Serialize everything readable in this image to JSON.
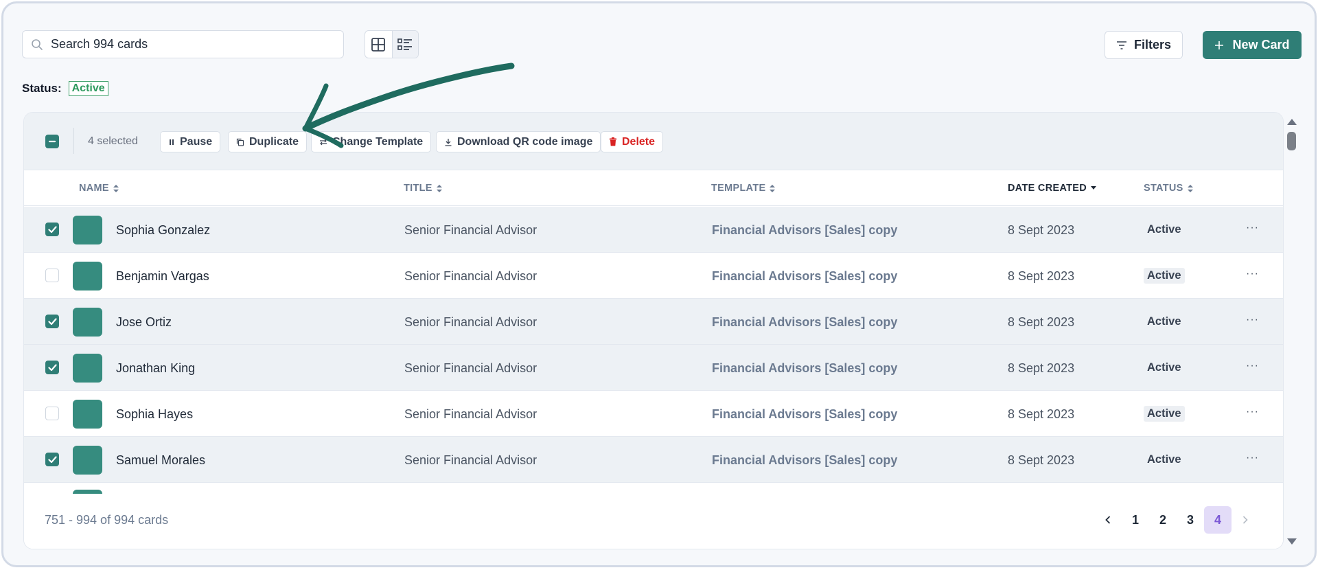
{
  "search": {
    "placeholder": "Search 994 cards"
  },
  "toolbar": {
    "filters_label": "Filters",
    "new_card_label": "New Card"
  },
  "status_filter": {
    "label": "Status:",
    "value": "Active"
  },
  "bulk": {
    "selected_text": "4 selected",
    "actions": {
      "pause": "Pause",
      "duplicate": "Duplicate",
      "change_template": "Change Template",
      "download_qr": "Download QR code image",
      "delete": "Delete"
    }
  },
  "table": {
    "headers": {
      "name": "NAME",
      "title": "TITLE",
      "template": "TEMPLATE",
      "date_created": "DATE CREATED",
      "status": "STATUS"
    },
    "rows": [
      {
        "selected": true,
        "name": "Sophia Gonzalez",
        "title": "Senior Financial Advisor",
        "template": "Financial Advisors [Sales] copy",
        "date": "8 Sept 2023",
        "status": "Active"
      },
      {
        "selected": false,
        "name": "Benjamin Vargas",
        "title": "Senior Financial Advisor",
        "template": "Financial Advisors [Sales] copy",
        "date": "8 Sept 2023",
        "status": "Active"
      },
      {
        "selected": true,
        "name": "Jose Ortiz",
        "title": "Senior Financial Advisor",
        "template": "Financial Advisors [Sales] copy",
        "date": "8 Sept 2023",
        "status": "Active"
      },
      {
        "selected": true,
        "name": "Jonathan King",
        "title": "Senior Financial Advisor",
        "template": "Financial Advisors [Sales] copy",
        "date": "8 Sept 2023",
        "status": "Active"
      },
      {
        "selected": false,
        "name": "Sophia Hayes",
        "title": "Senior Financial Advisor",
        "template": "Financial Advisors [Sales] copy",
        "date": "8 Sept 2023",
        "status": "Active"
      },
      {
        "selected": true,
        "name": "Samuel Morales",
        "title": "Senior Financial Advisor",
        "template": "Financial Advisors [Sales] copy",
        "date": "8 Sept 2023",
        "status": "Active"
      }
    ]
  },
  "footer": {
    "range_text": "751 - 994 of 994 cards",
    "pages": [
      "1",
      "2",
      "3",
      "4"
    ],
    "current_page": "4"
  },
  "colors": {
    "accent": "#2f7e76",
    "avatar": "#368c7f",
    "status_active": "#2f9a5f",
    "delete": "#d92323",
    "current_page_bg": "#e3dcf8"
  }
}
